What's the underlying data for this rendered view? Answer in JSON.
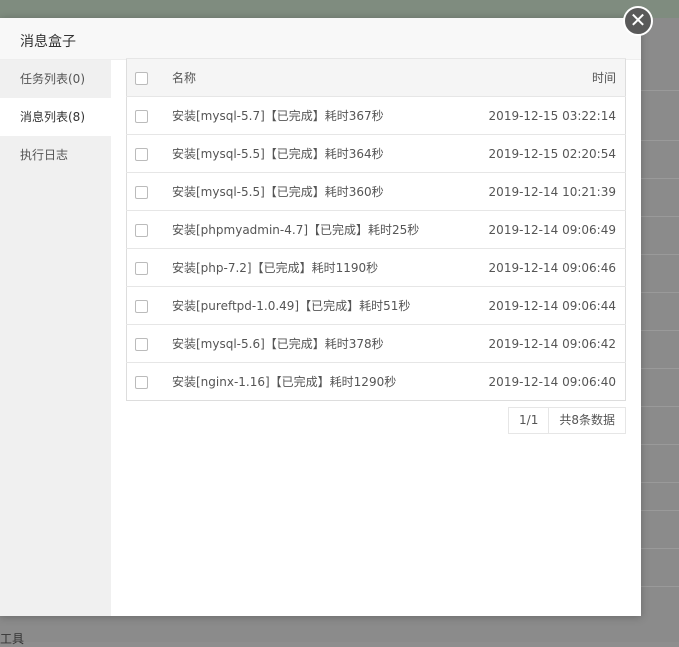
{
  "dialog": {
    "title": "消息盒子"
  },
  "sidebar": {
    "items": [
      {
        "label": "任务列表(0)"
      },
      {
        "label": "消息列表(8)"
      },
      {
        "label": "执行日志"
      }
    ]
  },
  "table": {
    "headers": {
      "name": "名称",
      "time": "时间"
    },
    "rows": [
      {
        "name": "安装[mysql-5.7]【已完成】耗时367秒",
        "time": "2019-12-15 03:22:14"
      },
      {
        "name": "安装[mysql-5.5]【已完成】耗时364秒",
        "time": "2019-12-15 02:20:54"
      },
      {
        "name": "安装[mysql-5.5]【已完成】耗时360秒",
        "time": "2019-12-14 10:21:39"
      },
      {
        "name": "安装[phpmyadmin-4.7]【已完成】耗时25秒",
        "time": "2019-12-14 09:06:49"
      },
      {
        "name": "安装[php-7.2]【已完成】耗时1190秒",
        "time": "2019-12-14 09:06:46"
      },
      {
        "name": "安装[pureftpd-1.0.49]【已完成】耗时51秒",
        "time": "2019-12-14 09:06:44"
      },
      {
        "name": "安装[mysql-5.6]【已完成】耗时378秒",
        "time": "2019-12-14 09:06:42"
      },
      {
        "name": "安装[nginx-1.16]【已完成】耗时1290秒",
        "time": "2019-12-14 09:06:40"
      }
    ]
  },
  "pager": {
    "page": "1/1",
    "total": "共8条数据"
  },
  "background": {
    "bottom_text": "工具"
  }
}
